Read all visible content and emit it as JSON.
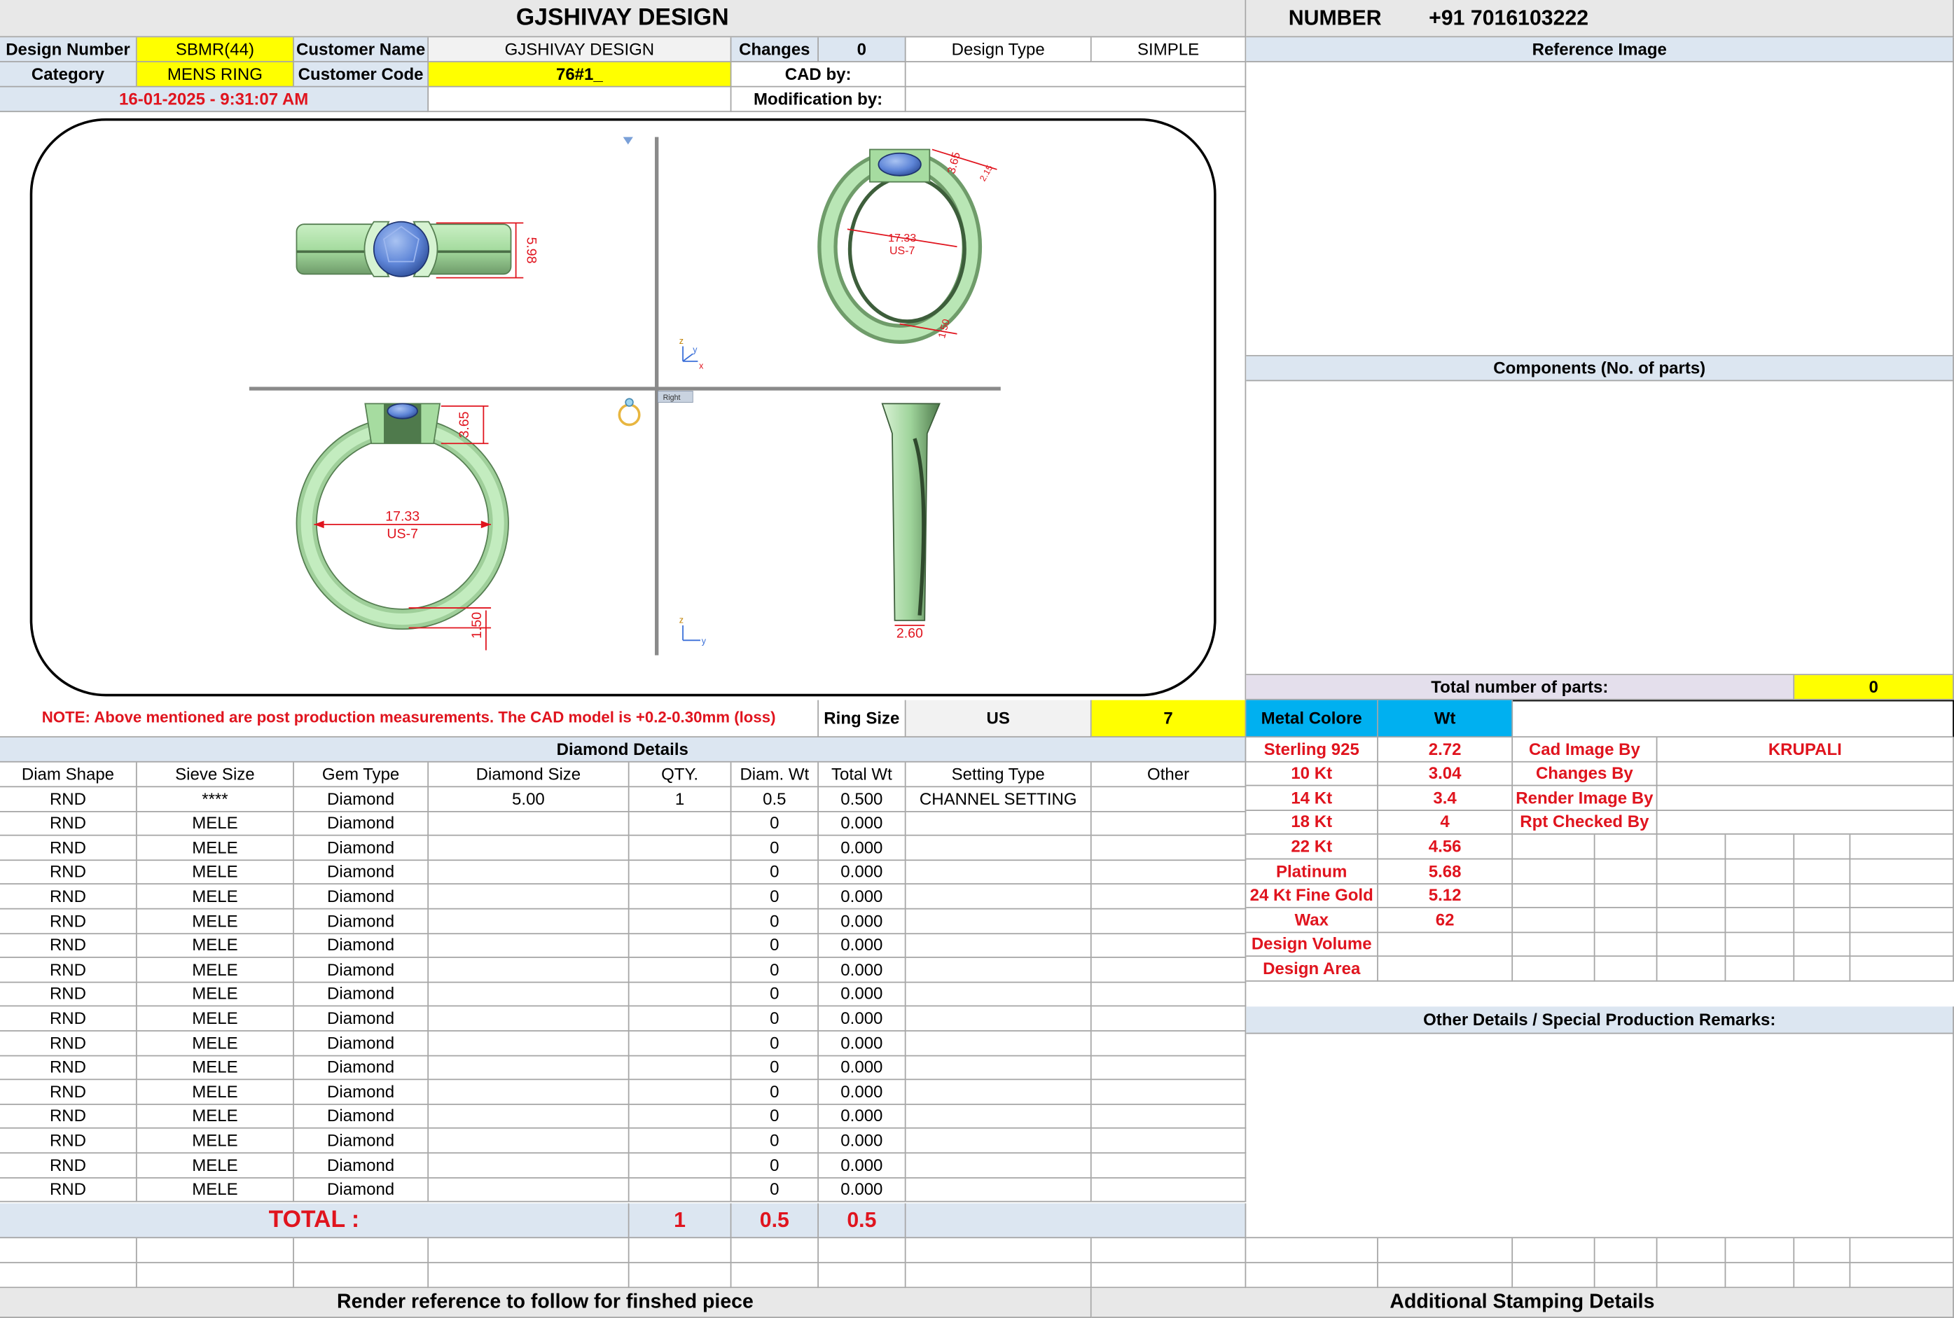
{
  "header": {
    "title": "GJSHIVAY DESIGN",
    "number_label": "NUMBER",
    "number_value": "+91 7016103222"
  },
  "info": {
    "design_number_label": "Design Number",
    "design_number": "SBMR(44)",
    "customer_name_label": "Customer Name",
    "customer_name": "GJSHIVAY DESIGN",
    "changes_label": "Changes",
    "changes": "0",
    "design_type_label": "Design Type",
    "design_type": "SIMPLE",
    "category_label": "Category",
    "category": "MENS RING",
    "customer_code_label": "Customer Code",
    "customer_code": "76#1_",
    "cad_by_label": "CAD by:",
    "cad_by": "",
    "date": "16-01-2025 - 9:31:07 AM",
    "modification_by_label": "Modification by:",
    "modification_by": ""
  },
  "drawing": {
    "top_view": {
      "dim": "5.98"
    },
    "perspective": {
      "dim_top": "3.65",
      "dim_side": "2.15",
      "dim_inner": "17.33",
      "dim_inner_size": "US-7",
      "dim_bottom": "1.50"
    },
    "front_view": {
      "dim_top": "3.65",
      "inner_dia": "17.33",
      "inner_size": "US-7",
      "dim_bottom": "1.50"
    },
    "side_view": {
      "dim_bottom": "2.60"
    },
    "viewport_label": "Right",
    "axis_x": "x",
    "axis_y": "y",
    "axis_z": "z"
  },
  "reference": {
    "reference_image_label": "Reference Image",
    "components_label": "Components (No. of parts)",
    "total_parts_label": "Total number of parts:",
    "total_parts": "0"
  },
  "note": "NOTE: Above mentioned are post production measurements. The CAD model is +0.2-0.30mm (loss)",
  "ring_size": {
    "label": "Ring Size",
    "system": "US",
    "value": "7"
  },
  "metal": {
    "color_label": "Metal Colore",
    "wt_label": "Wt",
    "rows": [
      {
        "name": "Sterling 925",
        "wt": "2.72"
      },
      {
        "name": "10 Kt",
        "wt": "3.04"
      },
      {
        "name": "14 Kt",
        "wt": "3.4"
      },
      {
        "name": "18 Kt",
        "wt": "4"
      },
      {
        "name": "22 Kt",
        "wt": "4.56"
      },
      {
        "name": "Platinum",
        "wt": "5.68"
      },
      {
        "name": "24 Kt Fine Gold",
        "wt": "5.12"
      },
      {
        "name": "Wax",
        "wt": "62"
      },
      {
        "name": "Design Volume",
        "wt": ""
      },
      {
        "name": "Design Area",
        "wt": ""
      }
    ]
  },
  "credits": [
    {
      "label": "Cad Image By",
      "value": "KRUPALI"
    },
    {
      "label": "Changes By",
      "value": ""
    },
    {
      "label": "Render Image By",
      "value": ""
    },
    {
      "label": "Rpt Checked By",
      "value": ""
    }
  ],
  "other_details_label": "Other Details / Special Production Remarks:",
  "diamond": {
    "title": "Diamond Details",
    "headers": [
      "Diam Shape",
      "Sieve Size",
      "Gem Type",
      "Diamond Size",
      "QTY.",
      "Diam. Wt",
      "Total Wt",
      "Setting Type",
      "Other"
    ],
    "rows": [
      [
        "RND",
        "****",
        "Diamond",
        "5.00",
        "1",
        "0.5",
        "0.500",
        "CHANNEL SETTING",
        ""
      ],
      [
        "RND",
        "MELE",
        "Diamond",
        "",
        "",
        "0",
        "0.000",
        "",
        ""
      ],
      [
        "RND",
        "MELE",
        "Diamond",
        "",
        "",
        "0",
        "0.000",
        "",
        ""
      ],
      [
        "RND",
        "MELE",
        "Diamond",
        "",
        "",
        "0",
        "0.000",
        "",
        ""
      ],
      [
        "RND",
        "MELE",
        "Diamond",
        "",
        "",
        "0",
        "0.000",
        "",
        ""
      ],
      [
        "RND",
        "MELE",
        "Diamond",
        "",
        "",
        "0",
        "0.000",
        "",
        ""
      ],
      [
        "RND",
        "MELE",
        "Diamond",
        "",
        "",
        "0",
        "0.000",
        "",
        ""
      ],
      [
        "RND",
        "MELE",
        "Diamond",
        "",
        "",
        "0",
        "0.000",
        "",
        ""
      ],
      [
        "RND",
        "MELE",
        "Diamond",
        "",
        "",
        "0",
        "0.000",
        "",
        ""
      ],
      [
        "RND",
        "MELE",
        "Diamond",
        "",
        "",
        "0",
        "0.000",
        "",
        ""
      ],
      [
        "RND",
        "MELE",
        "Diamond",
        "",
        "",
        "0",
        "0.000",
        "",
        ""
      ],
      [
        "RND",
        "MELE",
        "Diamond",
        "",
        "",
        "0",
        "0.000",
        "",
        ""
      ],
      [
        "RND",
        "MELE",
        "Diamond",
        "",
        "",
        "0",
        "0.000",
        "",
        ""
      ],
      [
        "RND",
        "MELE",
        "Diamond",
        "",
        "",
        "0",
        "0.000",
        "",
        ""
      ],
      [
        "RND",
        "MELE",
        "Diamond",
        "",
        "",
        "0",
        "0.000",
        "",
        ""
      ],
      [
        "RND",
        "MELE",
        "Diamond",
        "",
        "",
        "0",
        "0.000",
        "",
        ""
      ],
      [
        "RND",
        "MELE",
        "Diamond",
        "",
        "",
        "0",
        "0.000",
        "",
        ""
      ]
    ],
    "total_label": "TOTAL :",
    "total_qty": "1",
    "total_diam_wt": "0.5",
    "total_wt": "0.5"
  },
  "footer": {
    "render_reference": "Render reference to follow for finshed piece",
    "stamping": "Additional Stamping Details"
  },
  "colors": {
    "yellow": "#ffff00",
    "blue_header": "#dce6f1",
    "metal_blue": "#00b0f0",
    "red": "#e0141e",
    "ring_green": "#b9e6b5",
    "stone_blue": "#5f86d8"
  },
  "chart_data": {
    "type": "table"
  }
}
